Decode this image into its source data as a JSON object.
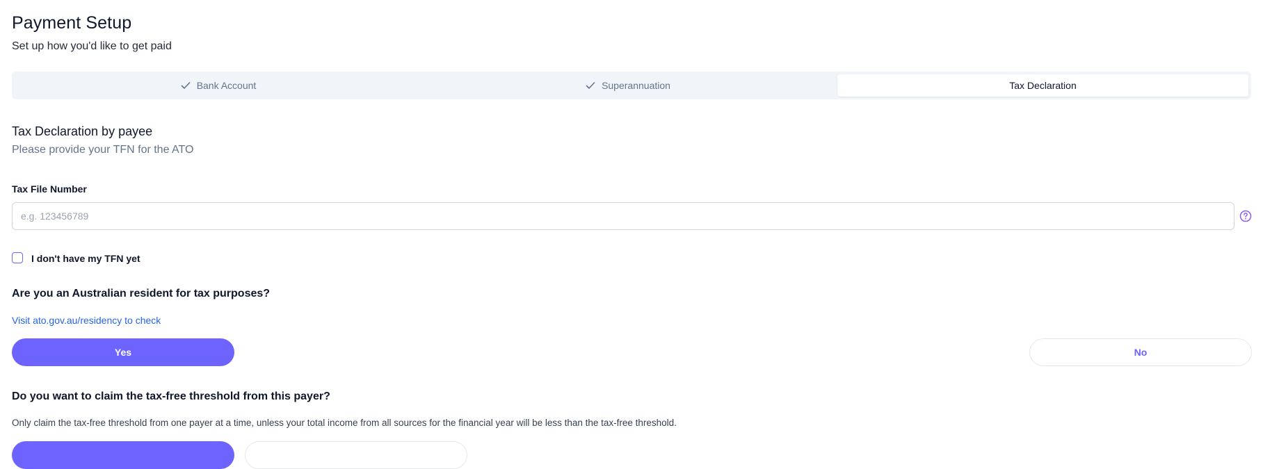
{
  "header": {
    "title": "Payment Setup",
    "subtitle": "Set up how you'd like to get paid"
  },
  "tabs": [
    {
      "label": "Bank Account",
      "completed": true
    },
    {
      "label": "Superannuation",
      "completed": true
    },
    {
      "label": "Tax Declaration",
      "active": true
    }
  ],
  "section": {
    "title": "Tax Declaration by payee",
    "subtitle": "Please provide your TFN for the ATO"
  },
  "tfn": {
    "label": "Tax File Number",
    "placeholder": "e.g. 123456789",
    "value": "",
    "no_tfn_label": "I don't have my TFN yet"
  },
  "residency": {
    "question": "Are you an Australian resident for tax purposes?",
    "link_text": "Visit ato.gov.au/residency to check",
    "yes_label": "Yes",
    "no_label": "No",
    "selected": "Yes"
  },
  "threshold": {
    "question": "Do you want to claim the tax-free threshold from this payer?",
    "note": "Only claim the tax-free threshold from one payer at a time, unless your total income from all sources for the financial year will be less than the tax-free threshold."
  },
  "colors": {
    "accent": "#6d63fe",
    "link": "#2563eb",
    "muted": "#64748b"
  },
  "icons": [
    "check-icon",
    "help-circle-icon"
  ]
}
